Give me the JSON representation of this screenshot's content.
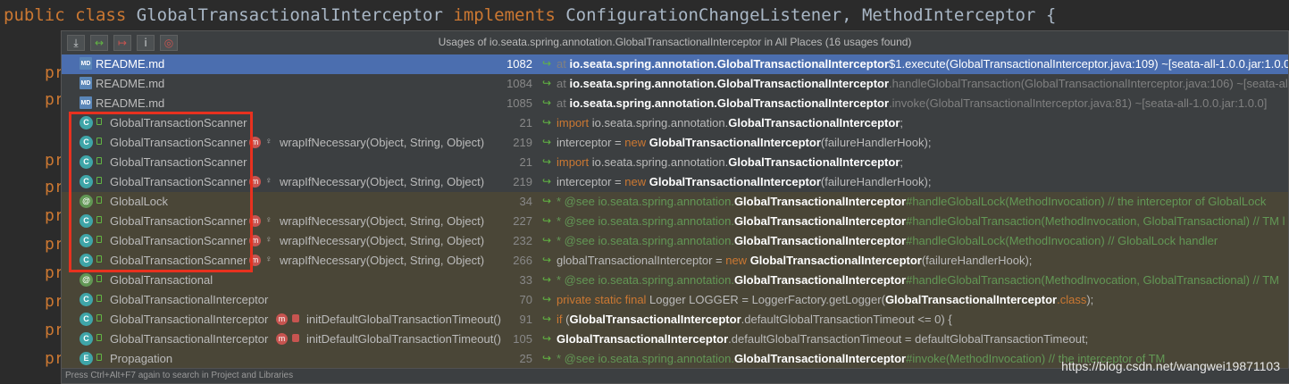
{
  "editor": {
    "code_keywords": [
      "public",
      "class"
    ],
    "class_name": "GlobalTransactionalInterceptor",
    "implements_kw": "implements",
    "interfaces": "ConfigurationChangeListener, MethodInterceptor {",
    "gutter_text": "pr"
  },
  "popup": {
    "title": "Usages of io.seata.spring.annotation.GlobalTransactionalInterceptor in All Places (16 usages found)",
    "toolbar": [
      {
        "name": "expand-all-icon",
        "glyph": "⤓"
      },
      {
        "name": "previous-occurrence-icon",
        "glyph": "↔"
      },
      {
        "name": "next-occurrence-icon",
        "glyph": "↦"
      },
      {
        "name": "info-icon",
        "glyph": "i"
      },
      {
        "name": "filter-icon",
        "glyph": "◎"
      }
    ],
    "status": "Press Ctrl+Alt+F7 again to search in Project and Libraries",
    "rows": [
      {
        "kind": "file",
        "file": "README.md",
        "method": "",
        "line": "1082",
        "snippet": [
          [
            "g",
            "at "
          ],
          [
            "b",
            "io.seata.spring.annotation.GlobalTransactionalInterceptor"
          ],
          [
            "n",
            "$1.execute(GlobalTransactionalInterceptor.java:109) ~[seata-all-1.0.0.jar:1.0.0]"
          ]
        ]
      },
      {
        "kind": "file",
        "file": "README.md",
        "method": "",
        "line": "1084",
        "snippet": [
          [
            "g",
            "at "
          ],
          [
            "b",
            "io.seata.spring.annotation.GlobalTransactionalInterceptor"
          ],
          [
            "g",
            ".handleGlobalTransaction(GlobalTransactionalInterceptor.java:106) ~[seata-all"
          ]
        ]
      },
      {
        "kind": "file",
        "file": "README.md",
        "method": "",
        "line": "1085",
        "snippet": [
          [
            "g",
            "at "
          ],
          [
            "b",
            "io.seata.spring.annotation.GlobalTransactionalInterceptor"
          ],
          [
            "g",
            ".invoke(GlobalTransactionalInterceptor.java:81) ~[seata-all-1.0.0.jar:1.0.0]"
          ]
        ]
      },
      {
        "kind": "class",
        "file": "GlobalTransactionScanner",
        "method": "",
        "line": "21",
        "snippet": [
          [
            "k",
            "import "
          ],
          [
            "n",
            "io.seata.spring.annotation."
          ],
          [
            "b",
            "GlobalTransactionalInterceptor"
          ],
          [
            "n",
            ";"
          ]
        ]
      },
      {
        "kind": "class",
        "file": "GlobalTransactionScanner",
        "method": "wrapIfNecessary(Object, String, Object)",
        "line": "219",
        "snippet": [
          [
            "n",
            "interceptor = "
          ],
          [
            "k",
            "new "
          ],
          [
            "b",
            "GlobalTransactionalInterceptor"
          ],
          [
            "n",
            "(failureHandlerHook);"
          ]
        ]
      },
      {
        "kind": "class",
        "file": "GlobalTransactionScanner",
        "method": "",
        "line": "21",
        "snippet": [
          [
            "k",
            "import "
          ],
          [
            "n",
            "io.seata.spring.annotation."
          ],
          [
            "b",
            "GlobalTransactionalInterceptor"
          ],
          [
            "n",
            ";"
          ]
        ]
      },
      {
        "kind": "class",
        "file": "GlobalTransactionScanner",
        "method": "wrapIfNecessary(Object, String, Object)",
        "line": "219",
        "snippet": [
          [
            "n",
            "interceptor = "
          ],
          [
            "k",
            "new "
          ],
          [
            "b",
            "GlobalTransactionalInterceptor"
          ],
          [
            "n",
            "(failureHandlerHook);"
          ]
        ]
      },
      {
        "kind": "anno",
        "file": "GlobalLock",
        "method": "",
        "line": "34",
        "alt": true,
        "snippet": [
          [
            "c",
            "* @see io.seata.spring.annotation."
          ],
          [
            "b",
            "GlobalTransactionalInterceptor"
          ],
          [
            "c",
            "#handleGlobalLock(MethodInvocation) // the interceptor of GlobalLock"
          ]
        ]
      },
      {
        "kind": "class",
        "file": "GlobalTransactionScanner",
        "method": "wrapIfNecessary(Object, String, Object)",
        "line": "227",
        "alt": true,
        "snippet": [
          [
            "c",
            "* @see io.seata.spring.annotation."
          ],
          [
            "b",
            "GlobalTransactionalInterceptor"
          ],
          [
            "c",
            "#handleGlobalTransaction(MethodInvocation, GlobalTransactional) // TM l"
          ]
        ]
      },
      {
        "kind": "class",
        "file": "GlobalTransactionScanner",
        "method": "wrapIfNecessary(Object, String, Object)",
        "line": "232",
        "alt": true,
        "snippet": [
          [
            "c",
            "* @see io.seata.spring.annotation."
          ],
          [
            "b",
            "GlobalTransactionalInterceptor"
          ],
          [
            "c",
            "#handleGlobalLock(MethodInvocation) // GlobalLock handler"
          ]
        ]
      },
      {
        "kind": "class",
        "file": "GlobalTransactionScanner",
        "method": "wrapIfNecessary(Object, String, Object)",
        "line": "266",
        "alt": true,
        "snippet": [
          [
            "n",
            "globalTransactionalInterceptor = "
          ],
          [
            "k",
            "new "
          ],
          [
            "b",
            "GlobalTransactionalInterceptor"
          ],
          [
            "n",
            "(failureHandlerHook);"
          ]
        ]
      },
      {
        "kind": "anno",
        "file": "GlobalTransactional",
        "method": "",
        "line": "33",
        "alt": true,
        "snippet": [
          [
            "c",
            "* @see io.seata.spring.annotation."
          ],
          [
            "b",
            "GlobalTransactionalInterceptor"
          ],
          [
            "c",
            "#handleGlobalTransaction(MethodInvocation, GlobalTransactional)  // TM"
          ]
        ]
      },
      {
        "kind": "class",
        "file": "GlobalTransactionalInterceptor",
        "method": "",
        "line": "70",
        "alt": true,
        "snippet": [
          [
            "k",
            "private static final "
          ],
          [
            "n",
            "Logger LOGGER = LoggerFactory.getLogger("
          ],
          [
            "b",
            "GlobalTransactionalInterceptor"
          ],
          [
            "k",
            ".class"
          ],
          [
            "n",
            ");"
          ]
        ]
      },
      {
        "kind": "class",
        "file": "GlobalTransactionalInterceptor",
        "method": "initDefaultGlobalTransactionTimeout()",
        "line": "91",
        "locked": true,
        "alt": true,
        "snippet": [
          [
            "k",
            "if "
          ],
          [
            "n",
            "("
          ],
          [
            "b",
            "GlobalTransactionalInterceptor"
          ],
          [
            "n",
            ".defaultGlobalTransactionTimeout <= 0) {"
          ]
        ]
      },
      {
        "kind": "class",
        "file": "GlobalTransactionalInterceptor",
        "method": "initDefaultGlobalTransactionTimeout()",
        "line": "105",
        "locked": true,
        "alt": true,
        "snippet": [
          [
            "b",
            "GlobalTransactionalInterceptor"
          ],
          [
            "n",
            ".defaultGlobalTransactionTimeout = defaultGlobalTransactionTimeout;"
          ]
        ]
      },
      {
        "kind": "enum",
        "file": "Propagation",
        "method": "",
        "line": "25",
        "alt": true,
        "snippet": [
          [
            "c",
            "* @see io.seata.spring.annotation."
          ],
          [
            "b",
            "GlobalTransactionalInterceptor"
          ],
          [
            "c",
            "#invoke(MethodInvocation) // the interceptor of TM"
          ]
        ]
      }
    ]
  },
  "watermark": "https://blog.csdn.net/wangwei19871103",
  "colors": {
    "selected": "#4b6eaf",
    "highlight": "#e8311f",
    "alt_row": "#4a4637"
  }
}
